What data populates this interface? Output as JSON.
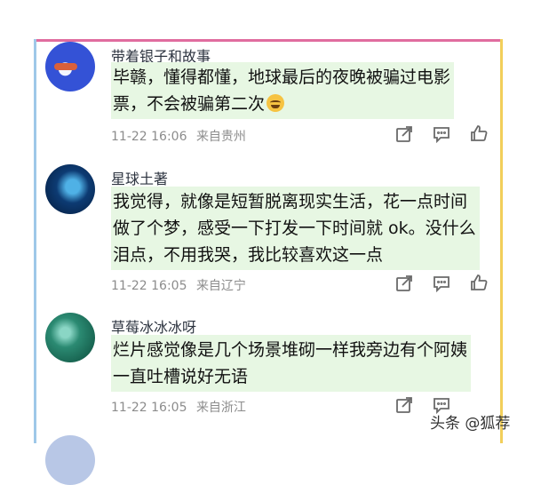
{
  "comments": [
    {
      "username": "带着银子和故事",
      "text": "毕赣，懂得都懂，地球最后的夜晚被骗过电影\n票，不会被骗第二次",
      "has_emoji": true,
      "emoji_name": "laughing-tears-emoji",
      "time": "11-22 16:06",
      "location": "来自贵州"
    },
    {
      "username": "星球土著",
      "text": "我觉得，就像是短暂脱离现实生活，花一点时间\n做了个梦，感受一下打发一下时间就 ok。没什么\n泪点，不用我哭，我比较喜欢这一点",
      "time": "11-22 16:05",
      "location": "来自辽宁"
    },
    {
      "username": "草莓冰冰冰呀",
      "text": "烂片感觉像是几个场景堆砌一样我旁边有个阿姨\n一直吐槽说好无语",
      "time": "11-22 16:05",
      "location": "来自浙江"
    }
  ],
  "icons": {
    "share": "share-icon",
    "reply": "comment-icon",
    "like": "thumbs-up-icon"
  },
  "watermark": "头条 @狐荐",
  "colors": {
    "highlight": "#e7f7e3",
    "frame_top": "#e06c9f",
    "frame_left": "#9ec8e8",
    "frame_right": "#f2cf5a"
  }
}
